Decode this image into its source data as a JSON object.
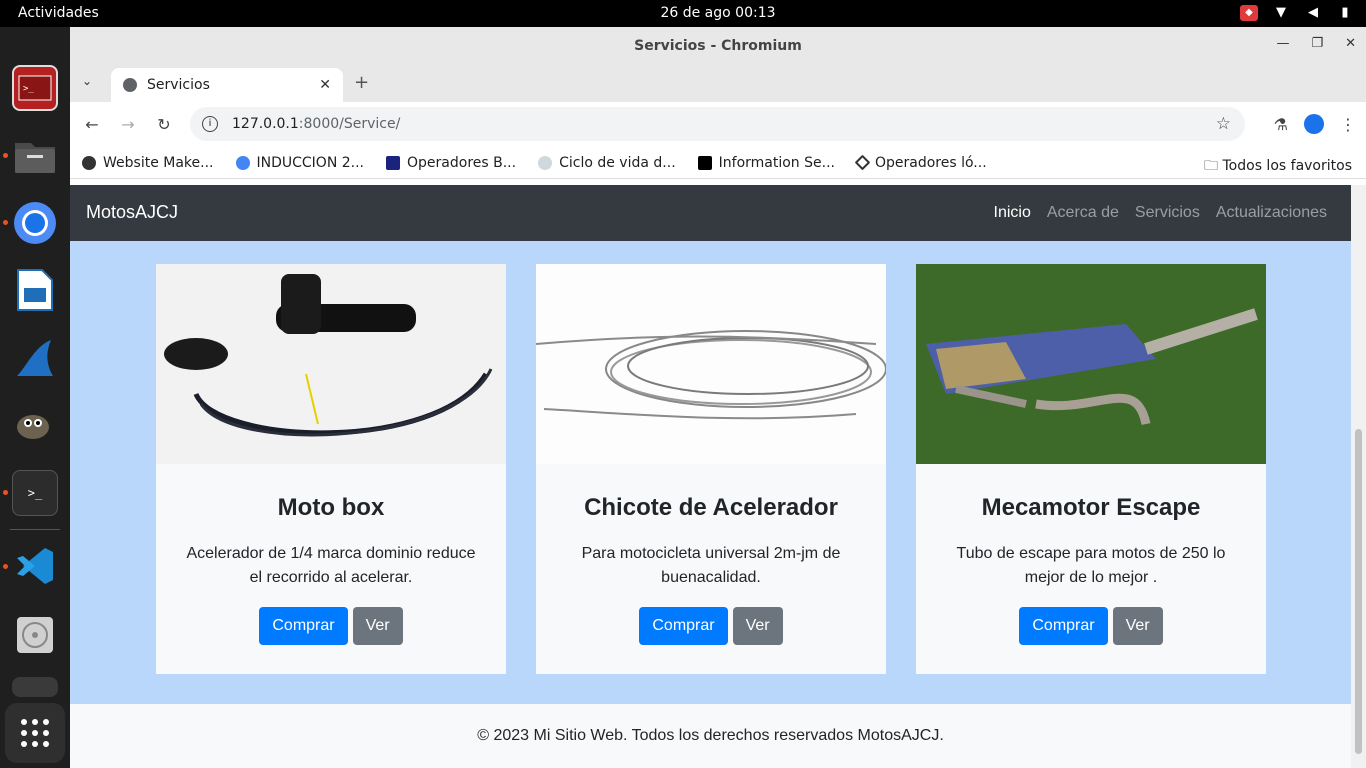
{
  "topbar": {
    "activities": "Actividades",
    "clock": "26 de ago  00:13"
  },
  "window": {
    "title": "Servicios - Chromium"
  },
  "tab": {
    "label": "Servicios"
  },
  "address": {
    "host": "127.0.0.1",
    "path": ":8000/Service/"
  },
  "bookmarks": {
    "items": [
      "Website Make...",
      "INDUCCION 2...",
      "Operadores B...",
      "Ciclo de vida d...",
      "Information Se...",
      "Operadores ló..."
    ],
    "all": "Todos los favoritos"
  },
  "site": {
    "brand": "MotosAJCJ",
    "nav": [
      "Inicio",
      "Acerca de",
      "Servicios",
      "Actualizaciones"
    ]
  },
  "cards": [
    {
      "title": "Moto box",
      "text": "Acelerador de 1/4 marca dominio reduce el recorrido al acelerar.",
      "buy": "Comprar",
      "view": "Ver"
    },
    {
      "title": "Chicote de Acelerador",
      "text": "Para motocicleta universal 2m-jm de buenacalidad.",
      "buy": "Comprar",
      "view": "Ver"
    },
    {
      "title": "Mecamotor Escape",
      "text": "Tubo de escape para motos de 250 lo mejor de lo mejor .",
      "buy": "Comprar",
      "view": "Ver"
    }
  ],
  "footer": {
    "text": "© 2023 Mi Sitio Web. Todos los derechos reservados MotosAJCJ."
  },
  "colors": {
    "page_bg": "#b8d7fb",
    "navbar_bg": "#343a40",
    "primary": "#007bff",
    "secondary": "#6c757d"
  }
}
